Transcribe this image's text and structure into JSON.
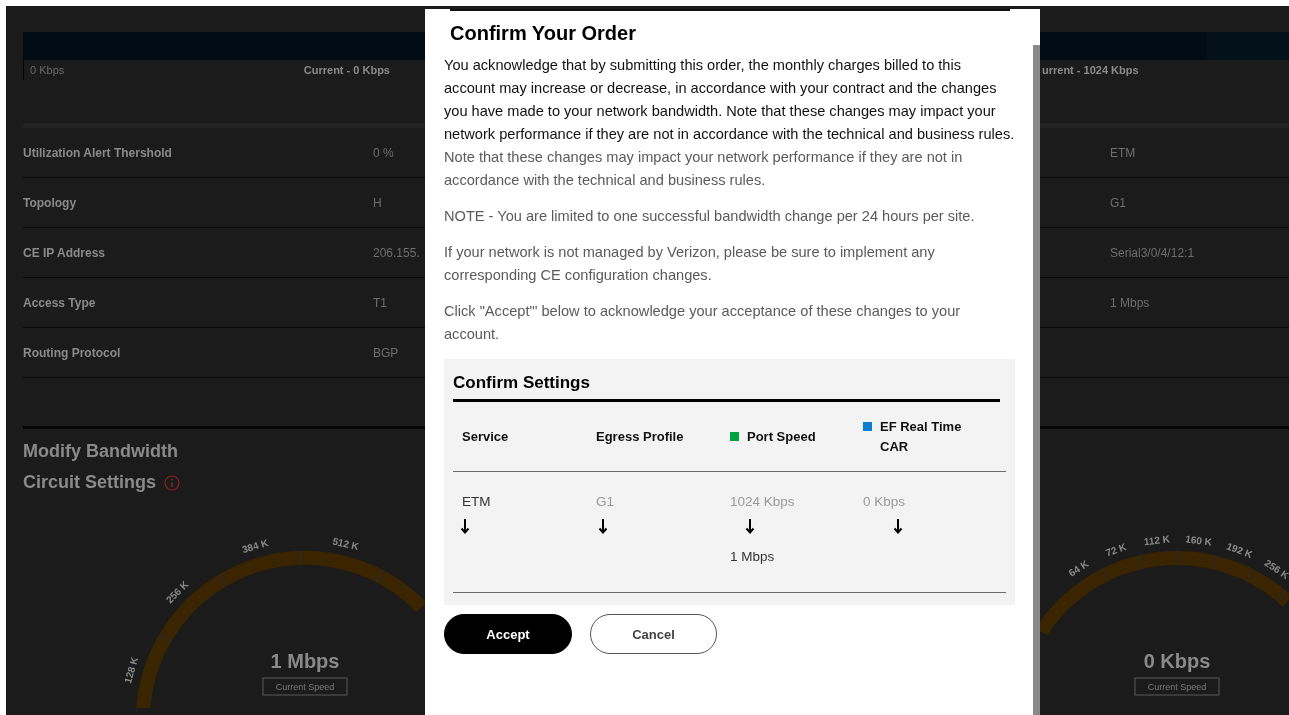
{
  "usage_bar": {
    "min_label": "0 Kbps",
    "current_left": "Current - 0 Kbps",
    "current_right": "urrent - 1024 Kbps"
  },
  "details": [
    {
      "label": "Utilization Alert Thershold",
      "value": "0 %",
      "right_value": "ETM"
    },
    {
      "label": "Topology",
      "value": "H",
      "right_value": "G1"
    },
    {
      "label": "CE IP Address",
      "value": "206.155.",
      "right_value": "Serial3/0/4/12:1"
    },
    {
      "label": "Access Type",
      "value": "T1",
      "right_value": "1 Mbps"
    },
    {
      "label": "Routing Protocol",
      "value": "BGP"
    }
  ],
  "modify_bandwidth": {
    "title": "Modify Bandwidth",
    "subtitle": "Circuit Settings"
  },
  "gauges": [
    {
      "tick_labels": [
        "128 K",
        "256 K",
        "384 K",
        "512 K"
      ],
      "reading": "1 Mbps",
      "caption": "Current Speed"
    },
    {
      "tick_labels": [
        "64 K",
        "72 K",
        "112 K",
        "160 K",
        "192 K",
        "256 K"
      ],
      "reading": "0 Kbps",
      "caption": "Current Speed"
    }
  ],
  "dialog": {
    "title": "Confirm Your Order",
    "paragraphs": [
      {
        "text": "You acknowledge that by submitting this order, the monthly charges billed to this account may increase or decrease, in accordance with your contract and the changes you have made to your network bandwidth. Note that these changes may impact your network performance if they are not in accordance with the technical and business rules.",
        "emphasis": true
      },
      {
        "text": "Note that these changes may impact your network performance if they are not in accordance with the technical and business rules.",
        "emphasis": false
      },
      {
        "text": "NOTE - You are limited to one successful bandwidth change per 24 hours per site.",
        "emphasis": false
      },
      {
        "text": "If your network is not managed by Verizon, please be sure to implement any corresponding CE configuration changes.",
        "emphasis": false
      },
      {
        "text": "Click \"Accept\"' below to acknowledge your acceptance of these changes to your account.",
        "emphasis": false
      }
    ],
    "settings": {
      "title": "Confirm Settings",
      "columns": [
        {
          "label": "Service",
          "from": "ETM",
          "muted": false
        },
        {
          "label": "Egress Profile",
          "from": "G1",
          "muted": true
        },
        {
          "label": "Port Speed",
          "color": "#00a33c",
          "from": "1024 Kbps",
          "muted": true,
          "to": "1 Mbps"
        },
        {
          "label": "EF Real Time CAR",
          "color": "#0a7fd0",
          "from": "0 Kbps",
          "muted": true
        }
      ]
    },
    "buttons": [
      {
        "label": "Accept",
        "primary": true
      },
      {
        "label": "Cancel",
        "primary": false
      }
    ]
  }
}
